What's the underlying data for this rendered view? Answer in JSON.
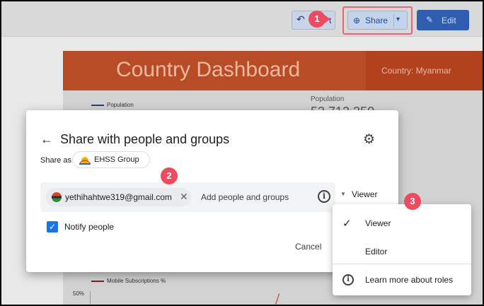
{
  "toolbar": {
    "undo_icon": "undo-icon",
    "undo_label": "t",
    "share_icon": "person-add-icon",
    "share_label": "Share",
    "share_caret": "▾",
    "edit_icon": "pencil-icon",
    "edit_label": "Edit"
  },
  "steps": [
    "1",
    "2",
    "3"
  ],
  "dashboard": {
    "title": "Country Dashboard",
    "country_label": "Country: Myanmar",
    "population_legend": "Population",
    "population_label": "Population",
    "population_value": "53 712 350",
    "mobile_legend": "Mobile Subscriptions %",
    "mobile_tick": "50%"
  },
  "dialog": {
    "title": "Share with people and groups",
    "share_as_label": "Share as",
    "group_name": "EHSS Group",
    "chip_email": "yethihahtwe319@gmail.com",
    "input_placeholder": "Add people and groups",
    "role_selected": "Viewer",
    "notify_label": "Notify people",
    "notify_checked": true,
    "cancel_label": "Cancel"
  },
  "role_menu": {
    "items": [
      "Viewer",
      "Editor"
    ],
    "selected": "Viewer",
    "learn_more": "Learn more about roles"
  },
  "colors": {
    "accent": "#1a73e8",
    "badge": "#ef4a5f",
    "dashboard_header": "#b84c27"
  }
}
